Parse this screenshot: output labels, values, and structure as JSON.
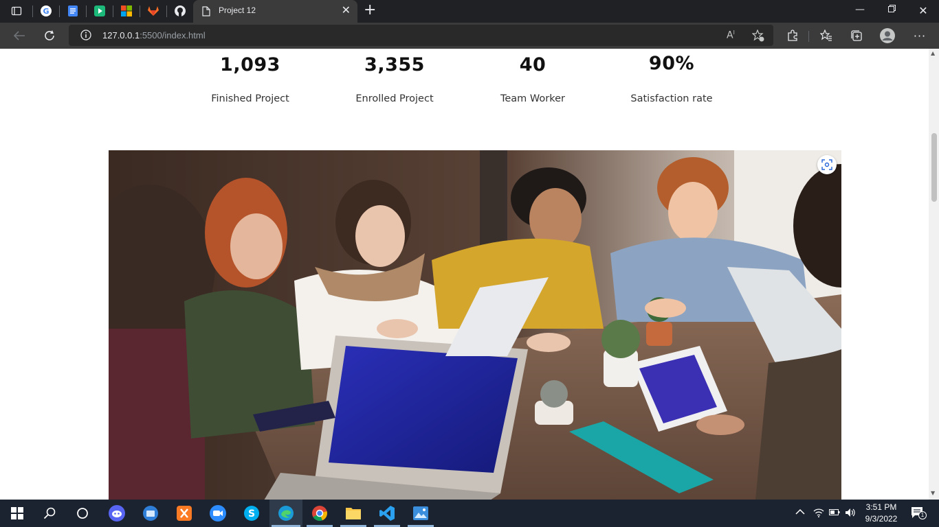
{
  "browser": {
    "tab_title": "Project 12",
    "url_host": "127.0.0.1",
    "url_path": ":5500/index.html"
  },
  "stats": [
    {
      "value": "1,093",
      "label": "Finished Project"
    },
    {
      "value": "3,355",
      "label": "Enrolled Project"
    },
    {
      "value": "40",
      "label": "Team Worker"
    },
    {
      "value": "90%",
      "label": "Satisfaction rate"
    }
  ],
  "taskbar": {
    "time": "3:51 PM",
    "date": "9/3/2022",
    "notification_count": "1"
  },
  "colors": {
    "browser_bg": "#202124",
    "toolbar_bg": "#3b3b3b",
    "taskbar_bg": "#1b2330"
  }
}
